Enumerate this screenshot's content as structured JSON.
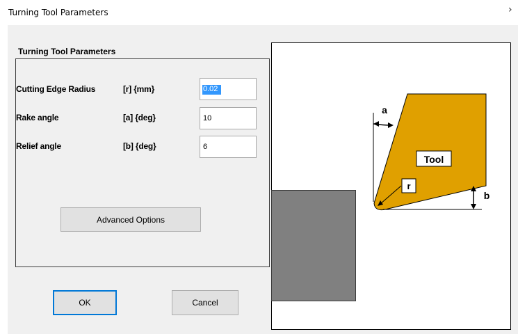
{
  "window": {
    "title": "Turning Tool Parameters",
    "close_glyph": "›"
  },
  "group": {
    "title": "Turning Tool Parameters"
  },
  "params": [
    {
      "label": "Cutting Edge Radius",
      "unit": "[r]  {mm}",
      "value": "0.02"
    },
    {
      "label": "Rake angle",
      "unit": "[a] {deg}",
      "value": "10"
    },
    {
      "label": "Relief angle",
      "unit": "[b] {deg}",
      "value": "6"
    }
  ],
  "buttons": {
    "advanced": "Advanced Options",
    "ok": "OK",
    "cancel": "Cancel"
  },
  "diagram": {
    "tool_label": "Tool",
    "label_a": "a",
    "label_b": "b",
    "label_r": "r",
    "tool_color": "#e0a000",
    "workpiece_color": "#808080"
  }
}
